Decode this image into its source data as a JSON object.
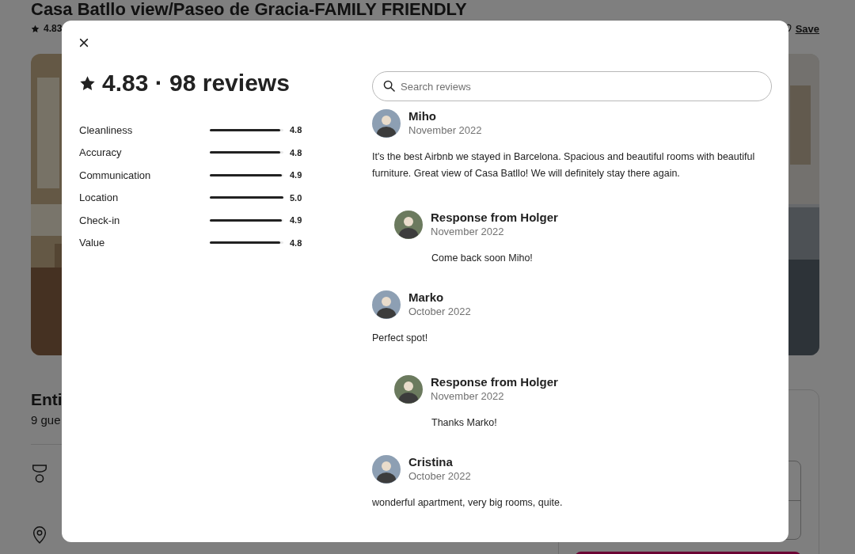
{
  "page": {
    "title": "Casa Batllo view/Paseo de Gracia-FAMILY FRIENDLY",
    "rating": "4.83",
    "save": "Save",
    "heading": "Enti",
    "subheading": "9 gue"
  },
  "modal": {
    "title": "4.83 · 98 reviews",
    "categories": [
      {
        "label": "Cleanliness",
        "score": "4.8",
        "level": 0.96
      },
      {
        "label": "Accuracy",
        "score": "4.8",
        "level": 0.96
      },
      {
        "label": "Communication",
        "score": "4.9",
        "level": 0.98
      },
      {
        "label": "Location",
        "score": "5.0",
        "level": 1
      },
      {
        "label": "Check-in",
        "score": "4.9",
        "level": 0.98
      },
      {
        "label": "Value",
        "score": "4.8",
        "level": 0.96
      }
    ],
    "search": {
      "placeholder": "Search reviews"
    },
    "reviews": [
      {
        "kind": "review",
        "name": "Miho",
        "date": "November 2022",
        "text": "It's the best Airbnb we stayed in Barcelona. Spacious and beautiful rooms with beautiful furniture. Great view of Casa Batllo! We will definitely stay there again."
      },
      {
        "kind": "response",
        "name": "Response from Holger",
        "date": "November 2022",
        "text": "Come back soon Miho!"
      },
      {
        "kind": "review",
        "name": "Marko",
        "date": "October 2022",
        "text": "Perfect spot!"
      },
      {
        "kind": "response",
        "name": "Response from Holger",
        "date": "November 2022",
        "text": "Thanks Marko!"
      },
      {
        "kind": "review",
        "name": "Cristina",
        "date": "October 2022",
        "text": "wonderful apartment, very big rooms, quite."
      }
    ]
  }
}
